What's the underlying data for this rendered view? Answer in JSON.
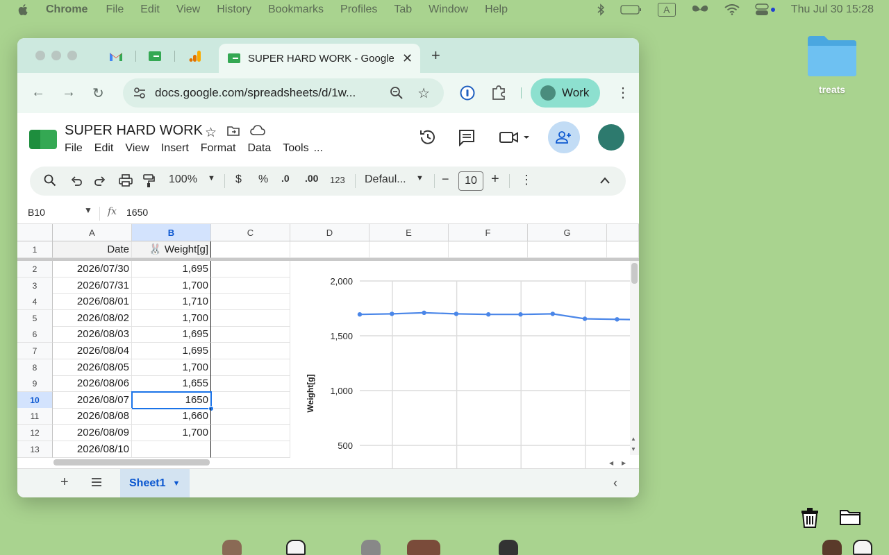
{
  "menubar": {
    "app_name": "Chrome",
    "items": [
      "File",
      "Edit",
      "View",
      "History",
      "Bookmarks",
      "Profiles",
      "Tab",
      "Window",
      "Help"
    ],
    "input_source": "A",
    "datetime": "Thu Jul 30  15:28"
  },
  "desktop": {
    "folder_label": "treats"
  },
  "browser": {
    "active_tab_title": "SUPER HARD WORK - Google",
    "url": "docs.google.com/spreadsheets/d/1w...",
    "profile_label": "Work"
  },
  "sheets": {
    "doc_title": "SUPER HARD WORK",
    "menu": [
      "File",
      "Edit",
      "View",
      "Insert",
      "Format",
      "Data",
      "Tools",
      "..."
    ],
    "toolbar": {
      "zoom": "100%",
      "currency": "$",
      "percent": "%",
      "dec_decrease": ".0",
      "dec_increase": ".00",
      "number_format": "123",
      "font": "Defaul...",
      "font_size": "10"
    },
    "name_box": "B10",
    "formula_value": "1650",
    "columns": [
      "A",
      "B",
      "C",
      "D",
      "E",
      "F",
      "G"
    ],
    "header_row": {
      "date": "Date",
      "weight": "🐰 Weight[g]"
    },
    "rows": [
      {
        "n": "2",
        "date": "2026/07/30",
        "weight": "1,695"
      },
      {
        "n": "3",
        "date": "2026/07/31",
        "weight": "1,700"
      },
      {
        "n": "4",
        "date": "2026/08/01",
        "weight": "1,710"
      },
      {
        "n": "5",
        "date": "2026/08/02",
        "weight": "1,700"
      },
      {
        "n": "6",
        "date": "2026/08/03",
        "weight": "1,695"
      },
      {
        "n": "7",
        "date": "2026/08/04",
        "weight": "1,695"
      },
      {
        "n": "8",
        "date": "2026/08/05",
        "weight": "1,700"
      },
      {
        "n": "9",
        "date": "2026/08/06",
        "weight": "1,655"
      },
      {
        "n": "10",
        "date": "2026/08/07",
        "weight": "1650"
      },
      {
        "n": "11",
        "date": "2026/08/08",
        "weight": "1,660"
      },
      {
        "n": "12",
        "date": "2026/08/09",
        "weight": "1,700"
      },
      {
        "n": "13",
        "date": "2026/08/10",
        "weight": ""
      }
    ],
    "selected_row": "10",
    "sheet_tab": "Sheet1"
  },
  "colors": {
    "desktop": "#a9d38f",
    "accent": "#1a73e8",
    "series": "#4a86e8"
  },
  "chart_data": {
    "type": "line",
    "x": [
      "2026/07/30",
      "2026/07/31",
      "2026/08/01",
      "2026/08/02",
      "2026/08/03",
      "2026/08/04",
      "2026/08/05",
      "2026/08/06",
      "2026/08/07"
    ],
    "series": [
      {
        "values": [
          1695,
          1700,
          1710,
          1700,
          1695,
          1695,
          1700,
          1655,
          1650
        ]
      }
    ],
    "ylabel": "Weight[g]",
    "y_ticks": [
      "2,000",
      "1,500",
      "1,000",
      "500"
    ],
    "y_tick_values": [
      2000,
      1500,
      1000,
      500
    ],
    "ylim": [
      400,
      2000
    ],
    "grid": true
  }
}
